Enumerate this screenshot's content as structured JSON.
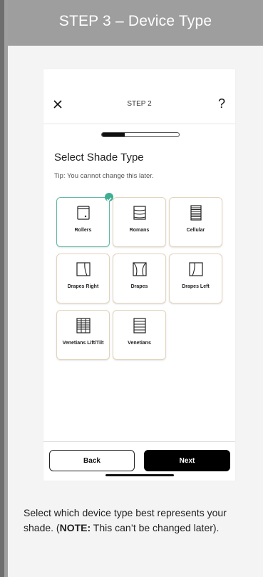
{
  "banner": {
    "title": "STEP 3 – Device Type"
  },
  "phone": {
    "step_label": "STEP 2",
    "close_label": "×",
    "help_label": "?",
    "progress": 0.3,
    "title": "Select Shade Type",
    "tip": "Tip: You cannot change this later.",
    "tiles": [
      {
        "label": "Rollers",
        "icon": "roller-shade-icon",
        "selected": true
      },
      {
        "label": "Romans",
        "icon": "roman-shade-icon",
        "selected": false
      },
      {
        "label": "Cellular",
        "icon": "cellular-shade-icon",
        "selected": false
      },
      {
        "label": "Drapes Right",
        "icon": "drapes-right-icon",
        "selected": false
      },
      {
        "label": "Drapes",
        "icon": "drapes-icon",
        "selected": false
      },
      {
        "label": "Drapes Left",
        "icon": "drapes-left-icon",
        "selected": false
      },
      {
        "label": "Venetians Lift/Tilt",
        "icon": "venetian-lift-tilt-icon",
        "selected": false
      },
      {
        "label": "Venetians",
        "icon": "venetian-icon",
        "selected": false
      }
    ],
    "back_label": "Back",
    "next_label": "Next"
  },
  "description": {
    "text_before": "Select which device type best represents your shade. (",
    "note_label": "NOTE:",
    "text_after": " This can’t be changed later)."
  },
  "colors": {
    "accent": "#3fae93",
    "tile_border": "#e2d4bd",
    "banner": "#9e9e9e"
  }
}
